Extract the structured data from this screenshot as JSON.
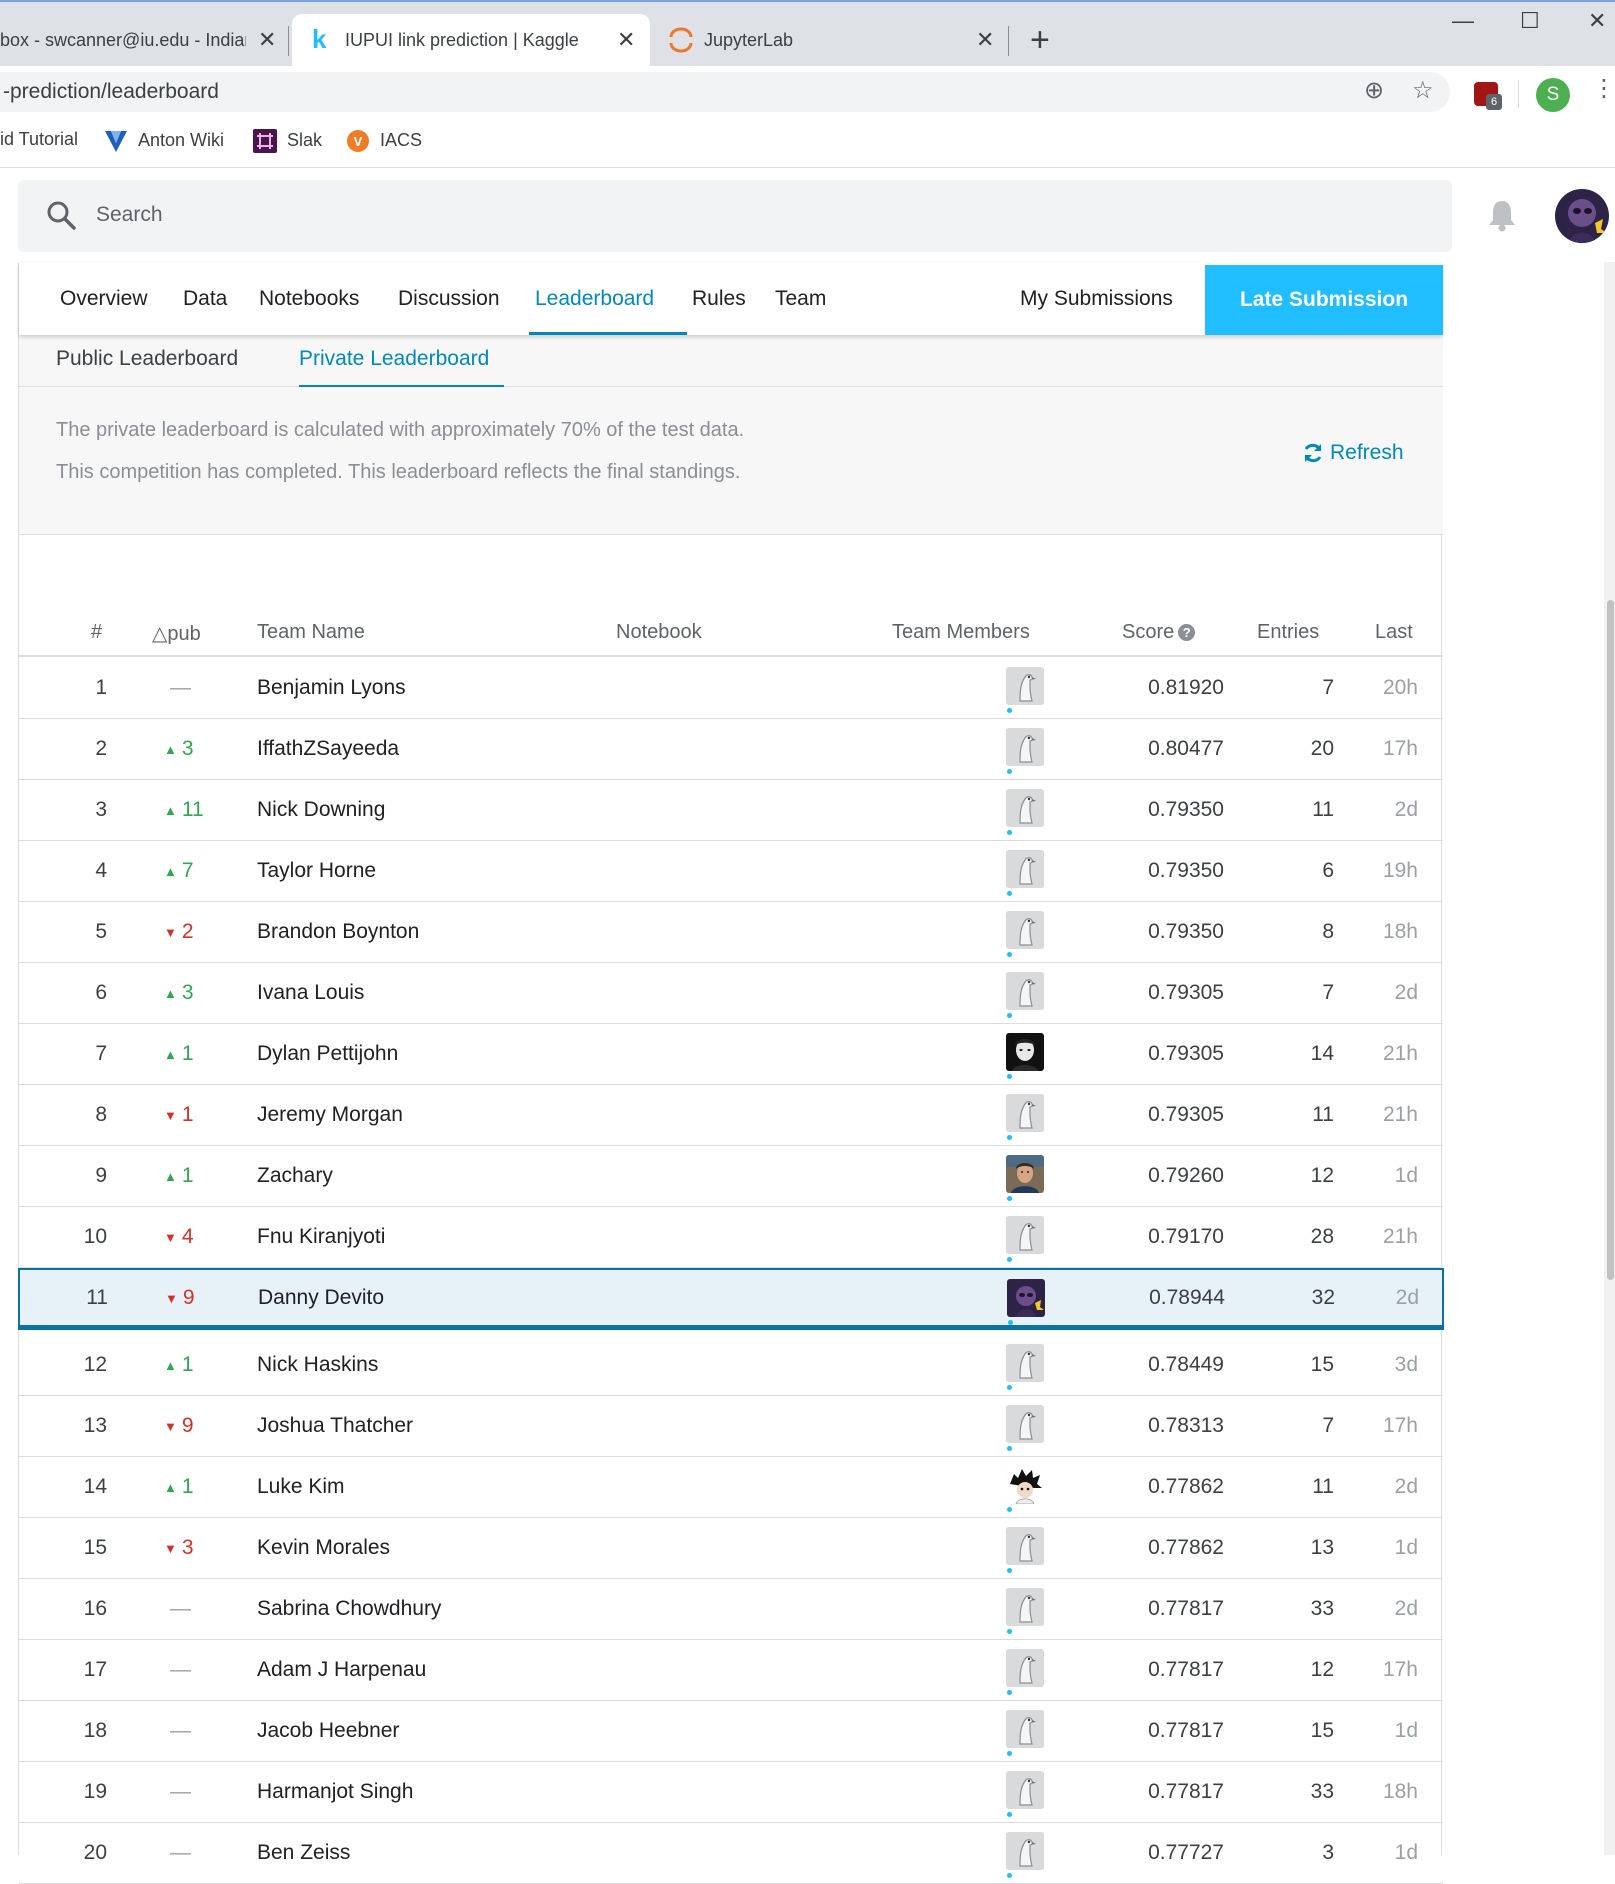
{
  "browser": {
    "tabs": [
      {
        "title": "box - swcanner@iu.edu - Indiana",
        "close": "✕"
      },
      {
        "title": "IUPUI link prediction | Kaggle",
        "close": "✕"
      },
      {
        "title": "JupyterLab",
        "close": "✕"
      }
    ],
    "new_tab": "+",
    "window_controls": {
      "minimize": "—",
      "maximize": "☐",
      "close": "✕"
    },
    "url": "-prediction/leaderboard",
    "extension_badge": "6",
    "profile_initial": "S",
    "bookmarks": [
      {
        "label": "id Tutorial",
        "icon": "none"
      },
      {
        "label": "Anton Wiki",
        "icon": "anton-wiki-icon"
      },
      {
        "label": "Slak",
        "icon": "slack-icon"
      },
      {
        "label": "IACS",
        "icon": "iacs-icon"
      }
    ]
  },
  "header": {
    "search_placeholder": "Search"
  },
  "competition_nav": {
    "items": [
      "Overview",
      "Data",
      "Notebooks",
      "Discussion",
      "Leaderboard",
      "Rules",
      "Team"
    ],
    "active": "Leaderboard",
    "my_submissions": "My Submissions",
    "late_submission": "Late Submission"
  },
  "leaderboard_tabs": {
    "public": "Public Leaderboard",
    "private": "Private Leaderboard",
    "active": "Private Leaderboard"
  },
  "info": {
    "line1": "The private leaderboard is calculated with approximately 70% of the test data.",
    "line2": "This competition has completed. This leaderboard reflects the final standings.",
    "refresh": "Refresh"
  },
  "table": {
    "headers": {
      "rank": "#",
      "delta": "△pub",
      "team_name": "Team Name",
      "notebook": "Notebook",
      "team_members": "Team Members",
      "score": "Score",
      "entries": "Entries",
      "last": "Last"
    },
    "rows": [
      {
        "rank": "1",
        "dir": "same",
        "delta": "—",
        "name": "Benjamin Lyons",
        "avatar": "default",
        "score": "0.81920",
        "entries": "7",
        "last": "20h"
      },
      {
        "rank": "2",
        "dir": "up",
        "delta": "3",
        "name": "IffathZSayeeda",
        "avatar": "default",
        "score": "0.80477",
        "entries": "20",
        "last": "17h"
      },
      {
        "rank": "3",
        "dir": "up",
        "delta": "11",
        "name": "Nick Downing",
        "avatar": "default",
        "score": "0.79350",
        "entries": "11",
        "last": "2d"
      },
      {
        "rank": "4",
        "dir": "up",
        "delta": "7",
        "name": "Taylor Horne",
        "avatar": "default",
        "score": "0.79350",
        "entries": "6",
        "last": "19h"
      },
      {
        "rank": "5",
        "dir": "down",
        "delta": "2",
        "name": "Brandon Boynton",
        "avatar": "default",
        "score": "0.79350",
        "entries": "8",
        "last": "18h"
      },
      {
        "rank": "6",
        "dir": "up",
        "delta": "3",
        "name": "Ivana Louis",
        "avatar": "default",
        "score": "0.79305",
        "entries": "7",
        "last": "2d"
      },
      {
        "rank": "7",
        "dir": "up",
        "delta": "1",
        "name": "Dylan Pettijohn",
        "avatar": "photo-dark",
        "score": "0.79305",
        "entries": "14",
        "last": "21h"
      },
      {
        "rank": "8",
        "dir": "down",
        "delta": "1",
        "name": "Jeremy Morgan",
        "avatar": "default",
        "score": "0.79305",
        "entries": "11",
        "last": "21h"
      },
      {
        "rank": "9",
        "dir": "up",
        "delta": "1",
        "name": "Zachary",
        "avatar": "photo-person",
        "score": "0.79260",
        "entries": "12",
        "last": "1d"
      },
      {
        "rank": "10",
        "dir": "down",
        "delta": "4",
        "name": "Fnu Kiranjyoti",
        "avatar": "default",
        "score": "0.79170",
        "entries": "28",
        "last": "21h"
      },
      {
        "rank": "11",
        "dir": "down",
        "delta": "9",
        "name": "Danny Devito",
        "avatar": "photo-purple",
        "score": "0.78944",
        "entries": "32",
        "last": "2d",
        "highlight": true
      },
      {
        "rank": "12",
        "dir": "up",
        "delta": "1",
        "name": "Nick Haskins",
        "avatar": "default",
        "score": "0.78449",
        "entries": "15",
        "last": "3d"
      },
      {
        "rank": "13",
        "dir": "down",
        "delta": "9",
        "name": "Joshua Thatcher",
        "avatar": "default",
        "score": "0.78313",
        "entries": "7",
        "last": "17h"
      },
      {
        "rank": "14",
        "dir": "up",
        "delta": "1",
        "name": "Luke Kim",
        "avatar": "photo-anime",
        "score": "0.77862",
        "entries": "11",
        "last": "2d"
      },
      {
        "rank": "15",
        "dir": "down",
        "delta": "3",
        "name": "Kevin Morales",
        "avatar": "default",
        "score": "0.77862",
        "entries": "13",
        "last": "1d"
      },
      {
        "rank": "16",
        "dir": "same",
        "delta": "—",
        "name": "Sabrina Chowdhury",
        "avatar": "default",
        "score": "0.77817",
        "entries": "33",
        "last": "2d"
      },
      {
        "rank": "17",
        "dir": "same",
        "delta": "—",
        "name": "Adam J Harpenau",
        "avatar": "default",
        "score": "0.77817",
        "entries": "12",
        "last": "17h"
      },
      {
        "rank": "18",
        "dir": "same",
        "delta": "—",
        "name": "Jacob Heebner",
        "avatar": "default",
        "score": "0.77817",
        "entries": "15",
        "last": "1d"
      },
      {
        "rank": "19",
        "dir": "same",
        "delta": "—",
        "name": "Harmanjot Singh",
        "avatar": "default",
        "score": "0.77817",
        "entries": "33",
        "last": "18h"
      },
      {
        "rank": "20",
        "dir": "same",
        "delta": "—",
        "name": "Ben Zeiss",
        "avatar": "default",
        "score": "0.77727",
        "entries": "3",
        "last": "1d"
      }
    ]
  },
  "colors": {
    "kaggle_blue": "#20beff",
    "active_link": "#008abc",
    "up": "#2fa84f",
    "down": "#d93025",
    "highlight_row": "#e6f1f8"
  }
}
